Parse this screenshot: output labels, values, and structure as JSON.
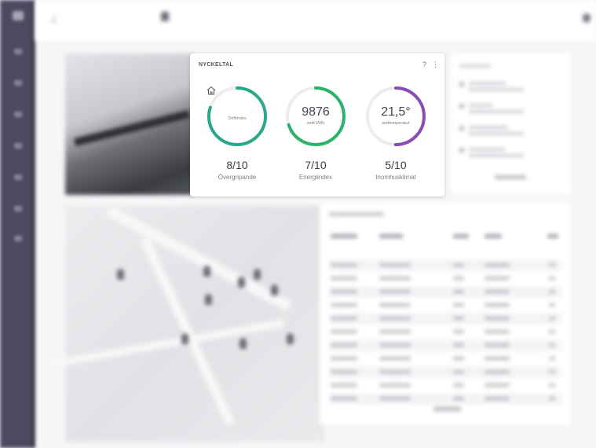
{
  "kpi": {
    "title": "NYCKELTAL",
    "help": "?",
    "menu": "⋮",
    "gauges": [
      {
        "icon": "home-icon",
        "value": "",
        "sub": "Driftindex",
        "score": "8/10",
        "label": "Övergripande",
        "fraction": 0.8,
        "color": "#2aa68b"
      },
      {
        "icon": "",
        "value": "9876",
        "sub": "snitt kWh",
        "score": "7/10",
        "label": "Energiindex",
        "fraction": 0.7,
        "color": "#2bb36a"
      },
      {
        "icon": "",
        "value": "21,5°",
        "sub": "snittemperatur",
        "score": "5/10",
        "label": "Inomhusklimat",
        "fraction": 0.5,
        "color": "#8a4db5"
      }
    ]
  },
  "colors": {
    "sidebar": "#4b4a5e",
    "track": "#ededf0"
  }
}
